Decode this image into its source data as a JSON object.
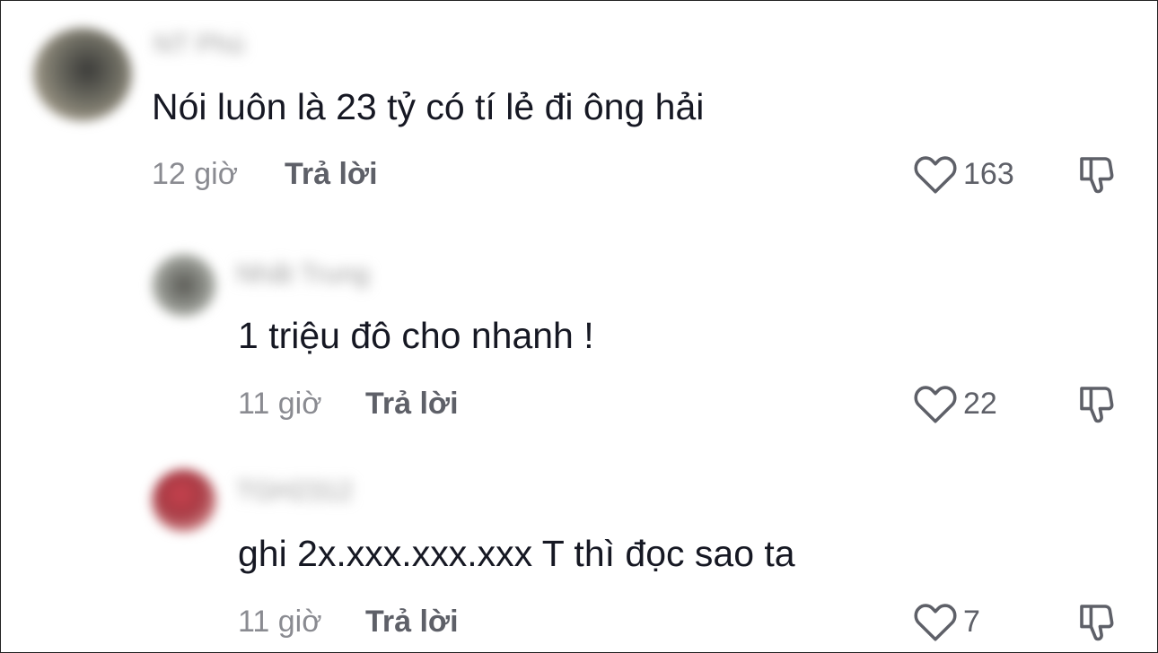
{
  "comments": [
    {
      "username": "NT Phú",
      "text": "Nói luôn là 23 tỷ có tí lẻ đi ông hải",
      "time": "12 giờ",
      "reply_label": "Trả lời",
      "likes": "163",
      "like_icon": "heart-outline-icon",
      "dislike_icon": "thumbs-down-icon"
    },
    {
      "username": "Nhất Trung",
      "text": "1 triệu đô cho nhanh !",
      "time": "11 giờ",
      "reply_label": "Trả lời",
      "likes": "22",
      "like_icon": "heart-outline-icon",
      "dislike_icon": "thumbs-down-icon"
    },
    {
      "username": "TGH2312",
      "text": "ghi 2x.xxx.xxx.xxx T thì đọc sao ta",
      "time": "11 giờ",
      "reply_label": "Trả lời",
      "likes": "7",
      "like_icon": "heart-outline-icon",
      "dislike_icon": "thumbs-down-icon"
    }
  ],
  "colors": {
    "text": "#161823",
    "muted": "#8a8b91",
    "reply": "#5e6068"
  }
}
